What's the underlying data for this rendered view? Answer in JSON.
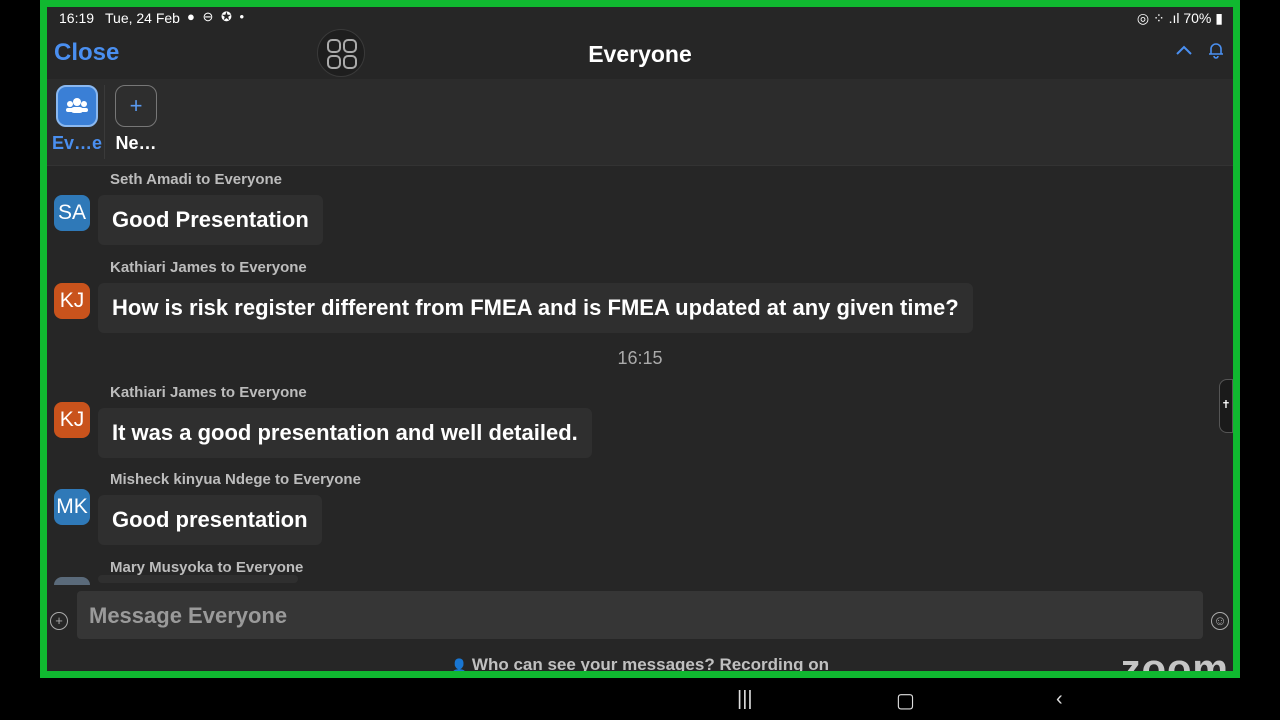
{
  "status_bar": {
    "time": "16:19",
    "date": "Tue, 24 Feb",
    "battery": "70%"
  },
  "header": {
    "close_label": "Close",
    "title": "Everyone"
  },
  "tabs": [
    {
      "label": "Ev…e",
      "active": true,
      "icon": "group-icon"
    },
    {
      "label": "Ne…",
      "active": false,
      "icon": "plus-icon"
    }
  ],
  "messages": [
    {
      "initials": "SA",
      "avatar_color": "#2f79b8",
      "sender": "Seth Amadi to Everyone",
      "text": "Good Presentation"
    },
    {
      "initials": "KJ",
      "avatar_color": "#c9531c",
      "sender": "Kathiari James to Everyone",
      "text": "How is risk register different from FMEA and is FMEA updated at any given time?"
    },
    {
      "initials": "KJ",
      "avatar_color": "#c9531c",
      "sender": "Kathiari James to Everyone",
      "text": "It was a good presentation and well detailed."
    },
    {
      "initials": "MK",
      "avatar_color": "#2f79b8",
      "sender": "Misheck kinyua Ndege to Everyone",
      "text": "Good presentation"
    },
    {
      "initials": "",
      "avatar_color": "#5a6a7a",
      "sender": "Mary Musyoka to Everyone",
      "text": ""
    }
  ],
  "time_separator": "16:15",
  "composer": {
    "placeholder": "Message Everyone"
  },
  "footer_text": "Who can see your messages? Recording on",
  "brand": "zoom",
  "colors": {
    "accent": "#4a8ff0",
    "frame_border": "#10b830"
  }
}
